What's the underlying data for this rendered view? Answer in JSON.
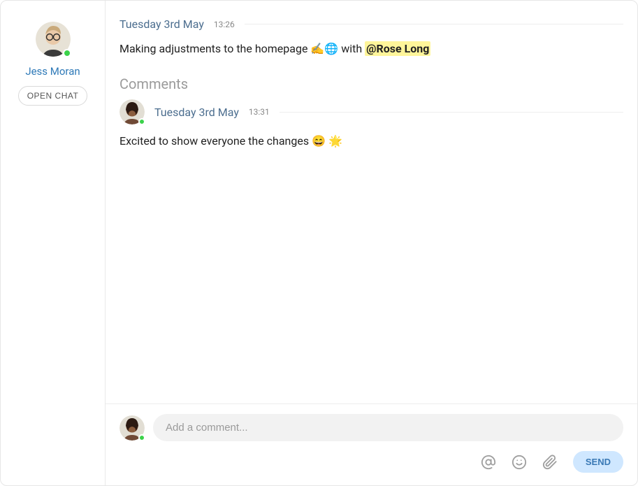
{
  "sidebar": {
    "author_name": "Jess Moran",
    "open_chat_label": "OPEN CHAT"
  },
  "post": {
    "date": "Tuesday 3rd May",
    "time": "13:26",
    "body_prefix": "Making adjustments to the homepage ✍️🌐 with ",
    "mention_text": "@Rose Long"
  },
  "comments": {
    "heading": "Comments",
    "items": [
      {
        "date": "Tuesday 3rd May",
        "time": "13:31",
        "body": "Excited to show everyone the changes 😄 🌟"
      }
    ]
  },
  "compose": {
    "placeholder": "Add a comment...",
    "send_label": "SEND"
  }
}
